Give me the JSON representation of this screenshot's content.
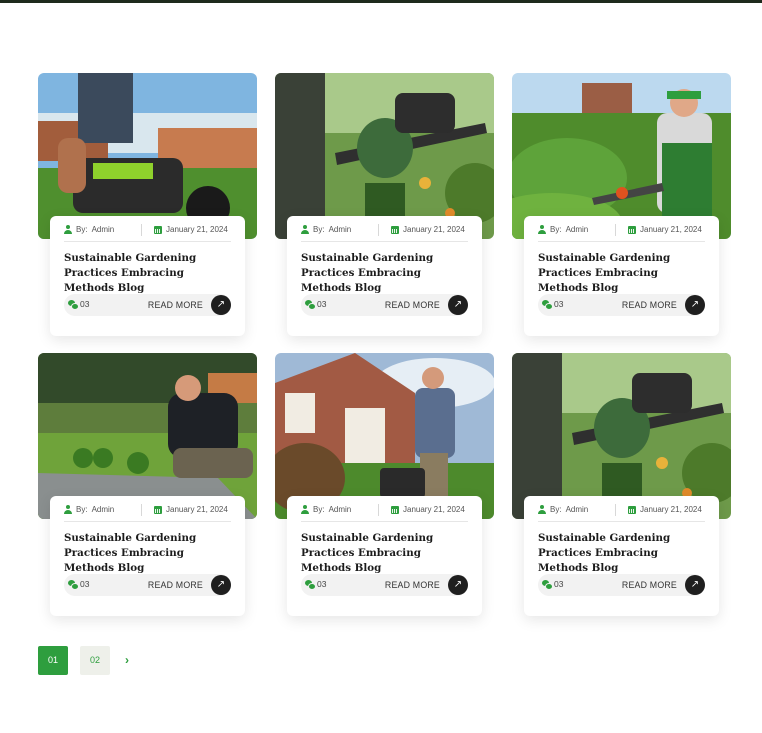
{
  "posts": [
    {
      "author": "Admin",
      "date": "January 21, 2024",
      "title": "Sustainable Gardening Practices Embracing Methods Blog",
      "comments": "03",
      "read_more": "READ MORE",
      "image": "lawn-mower-closeup"
    },
    {
      "author": "Admin",
      "date": "January 21, 2024",
      "title": "Sustainable Gardening Practices Embracing Methods Blog",
      "comments": "03",
      "read_more": "READ MORE",
      "image": "hedge-trimmer-gloves"
    },
    {
      "author": "Admin",
      "date": "January 21, 2024",
      "title": "Sustainable Gardening Practices Embracing Methods Blog",
      "comments": "03",
      "read_more": "READ MORE",
      "image": "gardener-trimming-shrubs"
    },
    {
      "author": "Admin",
      "date": "January 21, 2024",
      "title": "Sustainable Gardening Practices Embracing Methods Blog",
      "comments": "03",
      "read_more": "READ MORE",
      "image": "laying-paving-stones"
    },
    {
      "author": "Admin",
      "date": "January 21, 2024",
      "title": "Sustainable Gardening Practices Embracing Methods Blog",
      "comments": "03",
      "read_more": "READ MORE",
      "image": "man-mowing-lawn-house"
    },
    {
      "author": "Admin",
      "date": "January 21, 2024",
      "title": "Sustainable Gardening Practices Embracing Methods Blog",
      "comments": "03",
      "read_more": "READ MORE",
      "image": "hedge-trimmer-gloves"
    }
  ],
  "author_prefix": "By:",
  "pagination": {
    "pages": [
      "01",
      "02"
    ],
    "current": "01",
    "next_icon": "chevron-right-icon"
  },
  "colors": {
    "accent": "#2e9e3e",
    "dark": "#1f1f1f"
  }
}
